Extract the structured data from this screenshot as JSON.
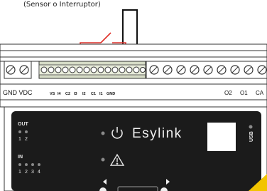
{
  "header_note": "(Sensor o Interruptor)",
  "power_label": "GND VDC",
  "input_labels": [
    "VS",
    "I4",
    "C2",
    "I3",
    "I2",
    "C1",
    "I1",
    "GND"
  ],
  "output_labels": [
    "O2",
    "O1",
    "CA"
  ],
  "status": {
    "out_label": "OUT",
    "out_numbers": [
      "1",
      "2"
    ],
    "in_label": "IN",
    "in_numbers": [
      "1",
      "2",
      "3",
      "4"
    ]
  },
  "brand": "Esylink",
  "usb_label": "USB",
  "icons": [
    "power-icon",
    "warning-icon",
    "usb-port-icon",
    "left-arrow-icon",
    "right-arrow-icon"
  ],
  "colors": {
    "panel": "#1b1b1b",
    "wire": "#e0312a",
    "led": "#8a8a8a",
    "accent": "#f2c400",
    "terminal_green": "#d6dcc6"
  }
}
